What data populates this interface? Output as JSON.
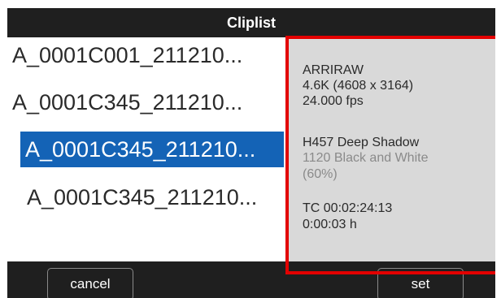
{
  "title": "Cliplist",
  "clips": [
    {
      "name": "A_0001C001_211210...",
      "selected": false
    },
    {
      "name": "A_0001C345_211210...",
      "selected": false
    },
    {
      "name": "A_0001C345_211210...",
      "selected": true
    },
    {
      "name": "A_0001C345_211210...",
      "selected": false
    }
  ],
  "info": {
    "format": "ARRIRAW",
    "resolution": "4.6K (4608 x 3164)",
    "fps": "24.000 fps",
    "look": "H457 Deep Shadow",
    "look_secondary": "1120 Black and White",
    "look_strength": "(60%)",
    "timecode": "TC 00:02:24:13",
    "duration": "0:00:03 h"
  },
  "buttons": {
    "cancel": "cancel",
    "set": "set"
  },
  "colors": {
    "selection": "#1463b6",
    "highlight": "#e30000",
    "bar": "#1f1f1f",
    "panel": "#d9d9d9"
  }
}
